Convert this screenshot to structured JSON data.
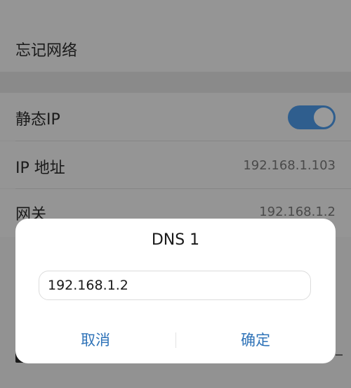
{
  "forget_network": {
    "label": "忘记网络"
  },
  "static_ip": {
    "label": "静态IP",
    "enabled": true
  },
  "ip_address": {
    "label": "IP 地址",
    "value": "192.168.1.103"
  },
  "gateway": {
    "label": "网关",
    "value": "192.168.1.2"
  },
  "dialog": {
    "title": "DNS 1",
    "input_value": "192.168.1.2",
    "cancel_label": "取消",
    "confirm_label": "确定"
  },
  "colors": {
    "accent": "#2f73b8",
    "toggle_on": "#2f5e8e"
  }
}
